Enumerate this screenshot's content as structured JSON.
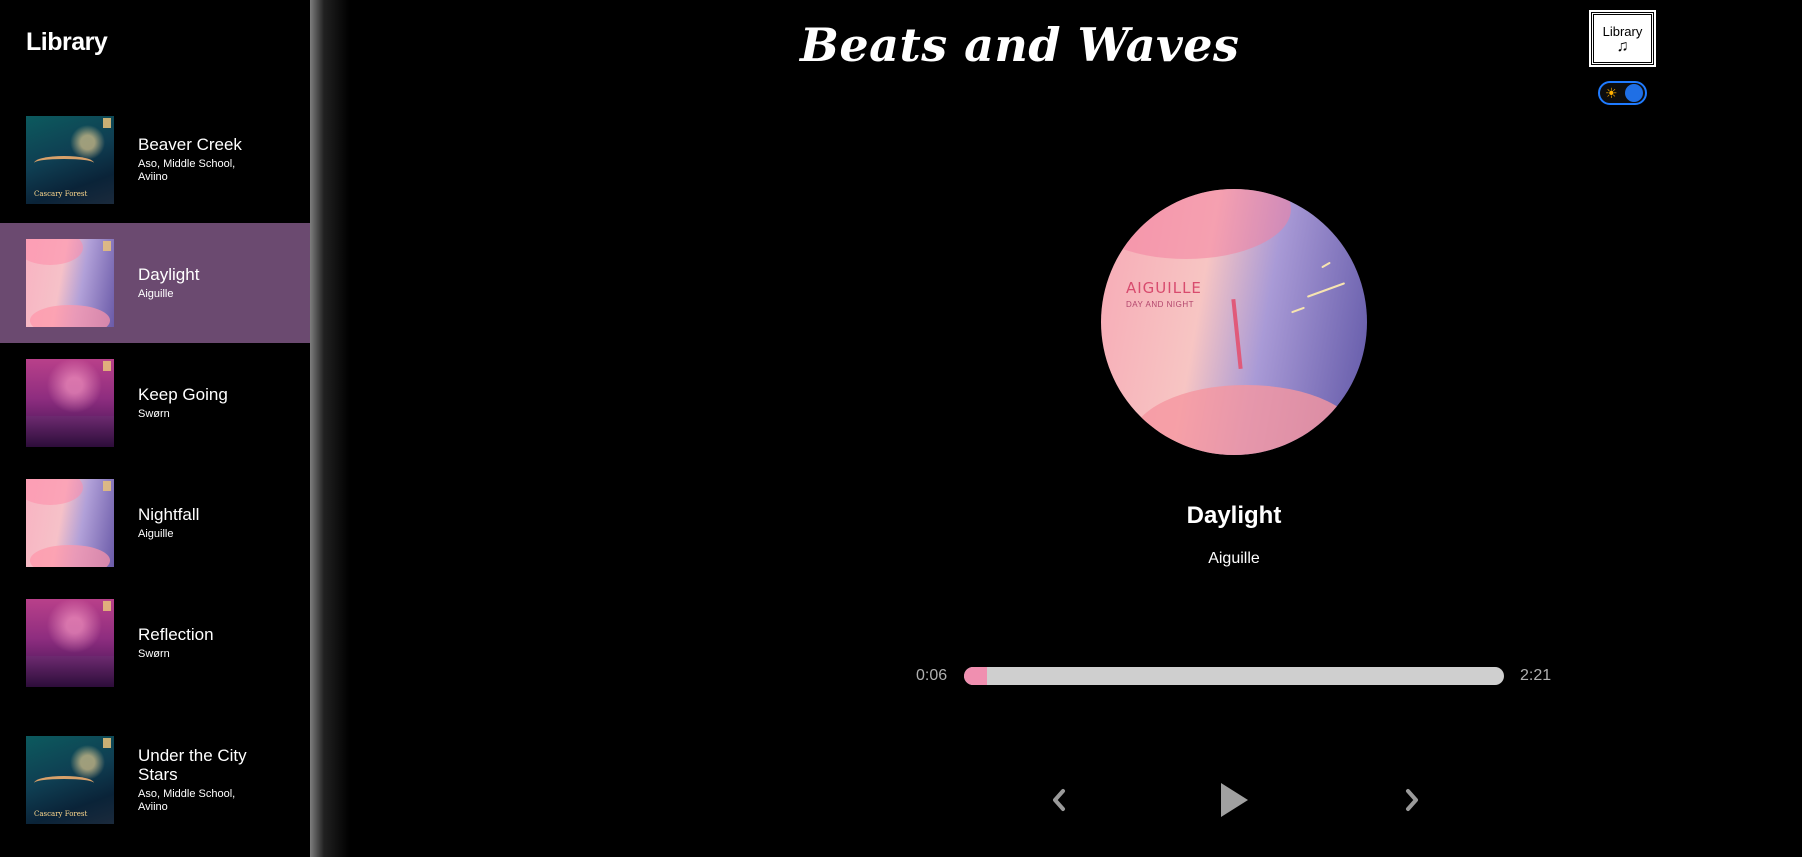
{
  "sidebar": {
    "title": "Library",
    "songs": [
      {
        "name": "Beaver Creek",
        "artist": "Aso, Middle School, Aviino",
        "active": false,
        "cover": "forest"
      },
      {
        "name": "Daylight",
        "artist": "Aiguille",
        "active": true,
        "cover": "daylight"
      },
      {
        "name": "Keep Going",
        "artist": "Swørn",
        "active": false,
        "cover": "dusk"
      },
      {
        "name": "Nightfall",
        "artist": "Aiguille",
        "active": false,
        "cover": "daylight"
      },
      {
        "name": "Reflection",
        "artist": "Swørn",
        "active": false,
        "cover": "dusk"
      },
      {
        "name": "Under the City Stars",
        "artist": "Aso, Middle School, Aviino",
        "active": false,
        "cover": "forest"
      }
    ],
    "forest_cover_caption": "Cascary Forest"
  },
  "header": {
    "title": "Beats and Waves",
    "library_button_label": "Library",
    "library_button_icon": "music-note-icon",
    "theme_toggle_icon": "sun-icon"
  },
  "now_playing": {
    "title": "Daylight",
    "artist": "Aiguille",
    "art_title": "AIGUILLE",
    "art_subtitle": "DAY AND NIGHT",
    "current_time": "0:06",
    "total_time": "2:21",
    "progress_fraction": 0.043
  },
  "controls": {
    "prev_icon": "chevron-left-icon",
    "play_icon": "play-icon",
    "next_icon": "chevron-right-icon"
  },
  "colors": {
    "active_item_bg": "#6b4a70",
    "progress_fill": "#f08fb0",
    "progress_track": "#cfcfcf",
    "toggle_accent": "#1f6fe5"
  }
}
